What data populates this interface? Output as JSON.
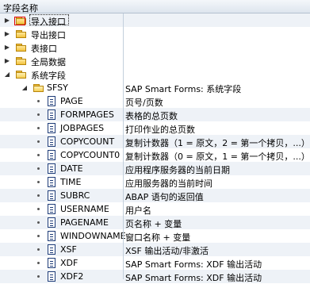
{
  "header": {
    "field_name": "字段名称"
  },
  "tree": {
    "top_folders": [
      {
        "label": "导入接口"
      },
      {
        "label": "导出接口"
      },
      {
        "label": "表接口"
      },
      {
        "label": "全局数据"
      },
      {
        "label": "系统字段"
      }
    ],
    "sfsy": {
      "label": "SFSY",
      "desc": "SAP Smart Forms: 系统字段"
    },
    "fields": [
      {
        "name": "PAGE",
        "desc": "页号/页数"
      },
      {
        "name": "FORMPAGES",
        "desc": "表格的总页数"
      },
      {
        "name": "JOBPAGES",
        "desc": "打印作业的总页数"
      },
      {
        "name": "COPYCOUNT",
        "desc": "复制计数器（1 = 原文，2 = 第一个拷贝，...）"
      },
      {
        "name": "COPYCOUNT0",
        "desc": "复制计数器（0 = 原文，1 = 第一个拷贝，...）"
      },
      {
        "name": "DATE",
        "desc": "应用程序服务器的当前日期"
      },
      {
        "name": "TIME",
        "desc": "应用服务器的当前时间"
      },
      {
        "name": "SUBRC",
        "desc": "ABAP 语句的返回值"
      },
      {
        "name": "USERNAME",
        "desc": "用户名"
      },
      {
        "name": "PAGENAME",
        "desc": "页名称 + 变量"
      },
      {
        "name": "WINDOWNAME",
        "desc": "窗口名称 + 变量"
      },
      {
        "name": "XSF",
        "desc": "XSF 输出活动/非激活"
      },
      {
        "name": "XDF",
        "desc": "SAP Smart Forms: XDF 输出活动"
      },
      {
        "name": "XDF2",
        "desc": "SAP Smart Forms: XDF 输出活动"
      }
    ]
  },
  "icons": {
    "collapsed": "triangle-right-icon",
    "expanded": "triangle-down-icon",
    "folder": "folder-icon",
    "field": "field-document-icon"
  },
  "colors": {
    "folder": "#f2c23e",
    "selection_outline": "#e00000",
    "header_bg": "#dde5ee"
  }
}
